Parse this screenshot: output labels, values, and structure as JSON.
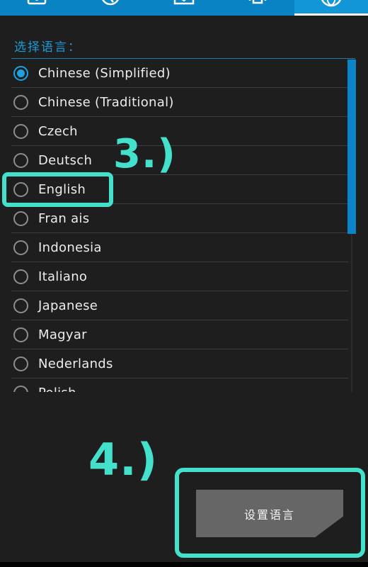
{
  "tabs": [
    {
      "icon": "settings-app-icon",
      "active": false
    },
    {
      "icon": "timer-icon",
      "active": false
    },
    {
      "icon": "sync-icon",
      "active": false
    },
    {
      "icon": "vibrate-icon",
      "active": false
    },
    {
      "icon": "globe-icon",
      "active": true
    }
  ],
  "section_title": "选择语言：",
  "languages": [
    {
      "label": "Chinese (Simplified)",
      "selected": true
    },
    {
      "label": "Chinese (Traditional)",
      "selected": false
    },
    {
      "label": "Czech",
      "selected": false
    },
    {
      "label": "Deutsch",
      "selected": false
    },
    {
      "label": "English",
      "selected": false
    },
    {
      "label": "Fran  ais",
      "selected": false
    },
    {
      "label": "Indonesia",
      "selected": false
    },
    {
      "label": "Italiano",
      "selected": false
    },
    {
      "label": "Japanese",
      "selected": false
    },
    {
      "label": "Magyar",
      "selected": false
    },
    {
      "label": "Nederlands",
      "selected": false
    },
    {
      "label": "Polish",
      "selected": false
    }
  ],
  "annotations": {
    "step3": "3.)",
    "step4": "4.)"
  },
  "set_language_button": "设置语言",
  "colors": {
    "accent": "#0a83c4",
    "annotation": "#43e0cc",
    "background": "#1e1e1e"
  }
}
